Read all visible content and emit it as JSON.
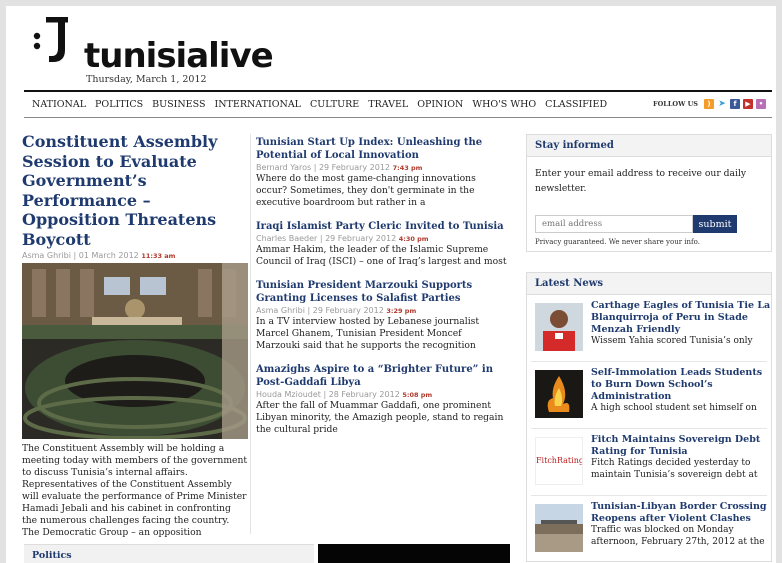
{
  "site": {
    "name": "tunisialive",
    "date": "Thursday, March 1, 2012"
  },
  "nav": {
    "items": [
      "NATIONAL",
      "POLITICS",
      "BUSINESS",
      "INTERNATIONAL",
      "CULTURE",
      "TRAVEL",
      "OPINION",
      "WHO'S WHO",
      "CLASSIFIED"
    ],
    "follow_label": "FOLLOW US",
    "social_icons": [
      "rss-icon",
      "twitter-icon",
      "facebook-icon",
      "youtube-icon",
      "flickr-icon"
    ]
  },
  "lead": {
    "title": "Constituent Assembly Session to Evaluate Government’s Performance – Opposition Threatens Boycott",
    "author": "Asma Ghribi | 01 March 2012",
    "time": "11:33 am",
    "summary": "The Constituent Assembly will be holding a meeting today with members of the government to discuss Tunisia’s internal affairs. Representatives of the Constituent Assembly will evaluate the performance of Prime Minister Hamadi Jebali and his cabinet in confronting the numerous challenges facing the country. The Democratic Group – an opposition"
  },
  "stories": [
    {
      "title": "Tunisian Start Up Index: Unleashing the Potential of Local Innovation",
      "author": "Bernard Yaros | 29 February 2012",
      "time": "7:43 pm",
      "summary": "Where do the most game-changing innovations occur? Sometimes, they don't germinate in the executive boardroom but rather in a"
    },
    {
      "title": "Iraqi Islamist Party Cleric Invited to Tunisia",
      "author": "Charles Baeder | 29 February 2012",
      "time": "4:30 pm",
      "summary": "Ammar Hakim, the leader of the Islamic Supreme Council of Iraq (ISCI) – one of Iraq’s largest and most"
    },
    {
      "title": "Tunisian President Marzouki Supports Granting Licenses to Salafist Parties",
      "author": "Asma Ghribi | 29 February 2012",
      "time": "3:29 pm",
      "summary": "In a TV interview hosted by Lebanese journalist Marcel Ghanem, Tunisian President Moncef Marzouki said that he supports the recognition"
    },
    {
      "title": "Amazighs Aspire to a “Brighter Future” in Post-Gaddafi Libya",
      "author": "Houda Mzioudet | 28 February 2012",
      "time": "5:08 pm",
      "summary": "After the fall of Muammar Gaddafi, one prominent Libyan minority, the Amazigh people, stand to regain the cultural pride"
    }
  ],
  "newsletter": {
    "heading": "Stay informed",
    "text": "Enter your email address to receive our daily newsletter.",
    "placeholder": "email address",
    "submit": "submit",
    "privacy": "Privacy guaranteed. We never share your info."
  },
  "latest": {
    "heading": "Latest News",
    "items": [
      {
        "title": "Carthage Eagles of Tunisia Tie La Blanquirroja of Peru in Stade Menzah Friendly",
        "summary": "Wissem Yahia scored Tunisia’s only"
      },
      {
        "title": "Self-Immolation Leads Students to Burn Down School’s Administration",
        "summary": "A high school student set himself on"
      },
      {
        "title": "Fitch Maintains Sovereign Debt Rating for Tunisia",
        "summary": "Fitch Ratings decided yesterday to maintain Tunisia’s sovereign debt at",
        "thumb_text": "FitchRatings"
      },
      {
        "title": "Tunisian-Libyan Border Crossing Reopens after Violent Clashes",
        "summary": "Traffic was blocked on Monday afternoon, February 27th, 2012 at the"
      }
    ]
  },
  "politics": {
    "heading": "Politics"
  }
}
